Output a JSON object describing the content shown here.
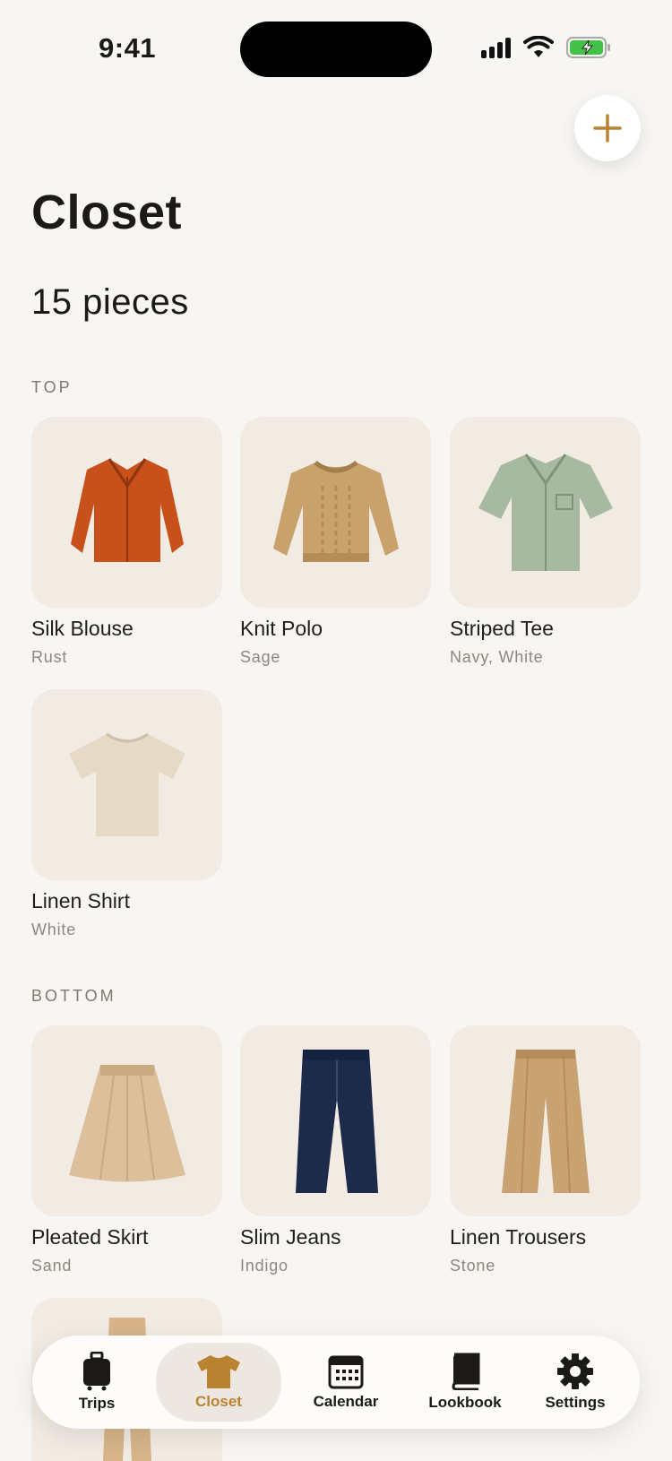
{
  "status": {
    "time": "9:41"
  },
  "header": {
    "title": "Closet",
    "count_text": "15 pieces"
  },
  "colors": {
    "accent": "#b98332",
    "background": "#f8f6f2",
    "card": "#f1ebe3"
  },
  "sections": [
    {
      "label": "TOP",
      "items": [
        {
          "name": "Silk Blouse",
          "color": "Rust",
          "icon": "blouse-image"
        },
        {
          "name": "Knit Polo",
          "color": "Sage",
          "icon": "sweater-image"
        },
        {
          "name": "Striped Tee",
          "color": "Navy, White",
          "icon": "shirt-image"
        },
        {
          "name": "Linen Shirt",
          "color": "White",
          "icon": "tshirt-image"
        }
      ]
    },
    {
      "label": "BOTTOM",
      "items": [
        {
          "name": "Pleated Skirt",
          "color": "Sand",
          "icon": "skirt-image"
        },
        {
          "name": "Slim Jeans",
          "color": "Indigo",
          "icon": "jeans-image"
        },
        {
          "name": "Linen Trousers",
          "color": "Stone",
          "icon": "trousers-image"
        }
      ]
    }
  ],
  "tabbar": {
    "items": [
      {
        "label": "Trips",
        "icon": "luggage-icon"
      },
      {
        "label": "Closet",
        "icon": "tshirt-icon",
        "active": true
      },
      {
        "label": "Calendar",
        "icon": "calendar-icon"
      },
      {
        "label": "Lookbook",
        "icon": "book-icon"
      },
      {
        "label": "Settings",
        "icon": "gear-icon"
      }
    ]
  }
}
